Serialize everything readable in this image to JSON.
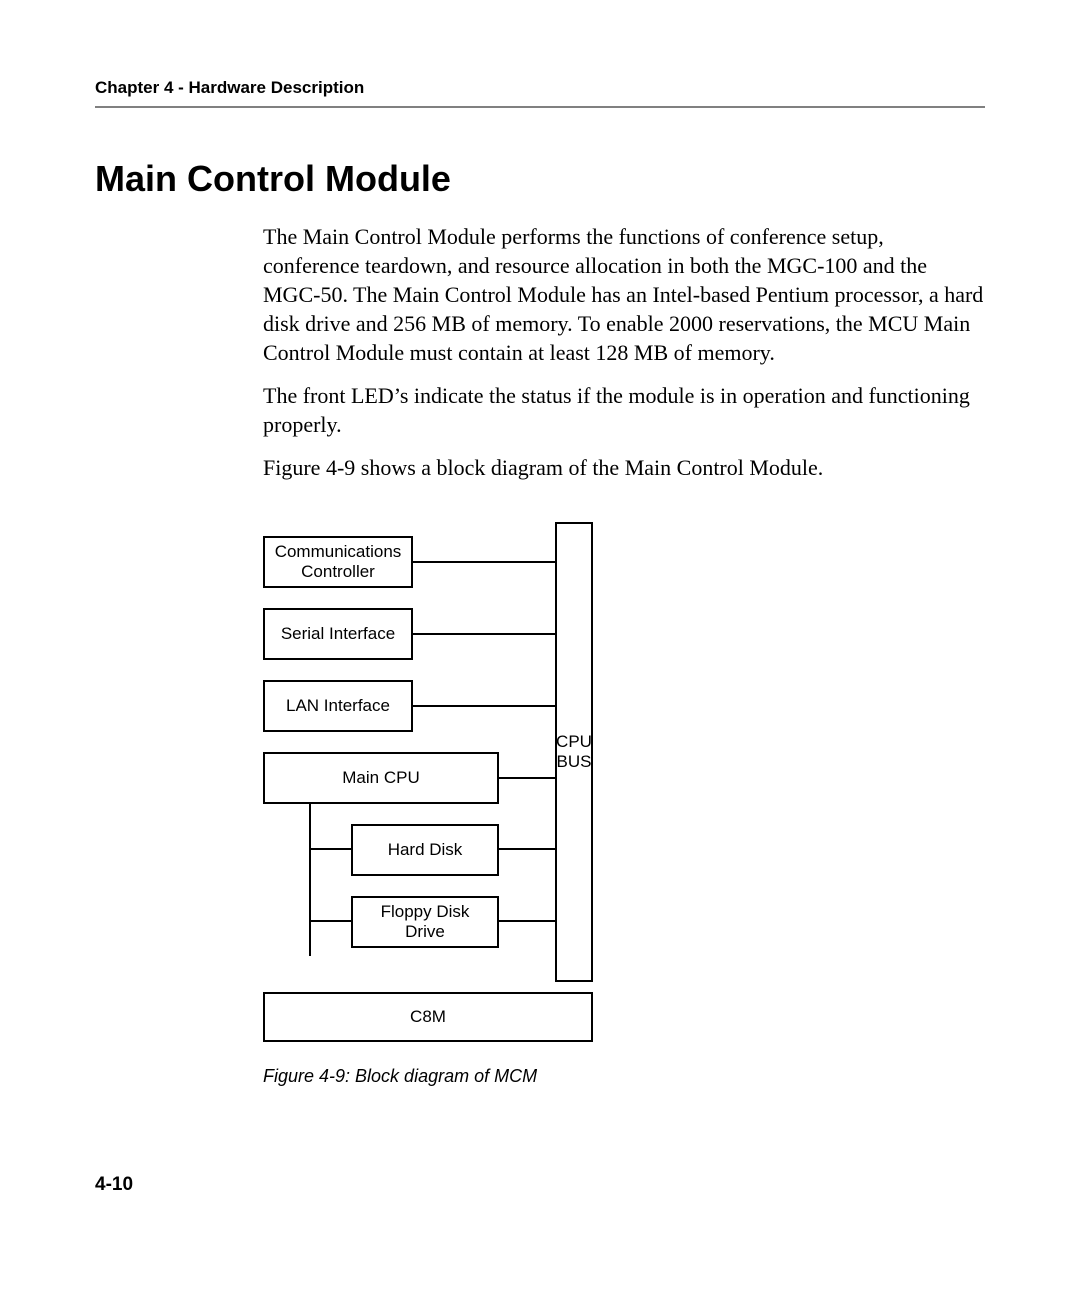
{
  "header": {
    "chapter": "Chapter 4 - Hardware Description"
  },
  "title": "Main Control Module",
  "paragraphs": {
    "p1": "The Main Control Module performs the functions of conference setup, conference teardown, and resource allocation in both the MGC-100 and the MGC-50. The Main Control Module has an Intel-based Pentium processor, a hard disk drive and 256 MB of memory. To enable 2000 reservations, the MCU Main Control Module must contain at least 128 MB of memory.",
    "p2": "The front LED’s indicate the status if the module is in operation and functioning properly.",
    "p3": "Figure 4-9 shows a block diagram of the Main Control Module."
  },
  "diagram": {
    "bus_label": "CPU BUS",
    "comm": "Communications Controller",
    "serial": "Serial Interface",
    "lan": "LAN Interface",
    "cpu": "Main CPU",
    "hd": "Hard Disk",
    "fd": "Floppy Disk Drive",
    "c8m": "C8M"
  },
  "caption": "Figure 4-9: Block diagram of MCM",
  "footer": {
    "pagenum": "4-10"
  }
}
